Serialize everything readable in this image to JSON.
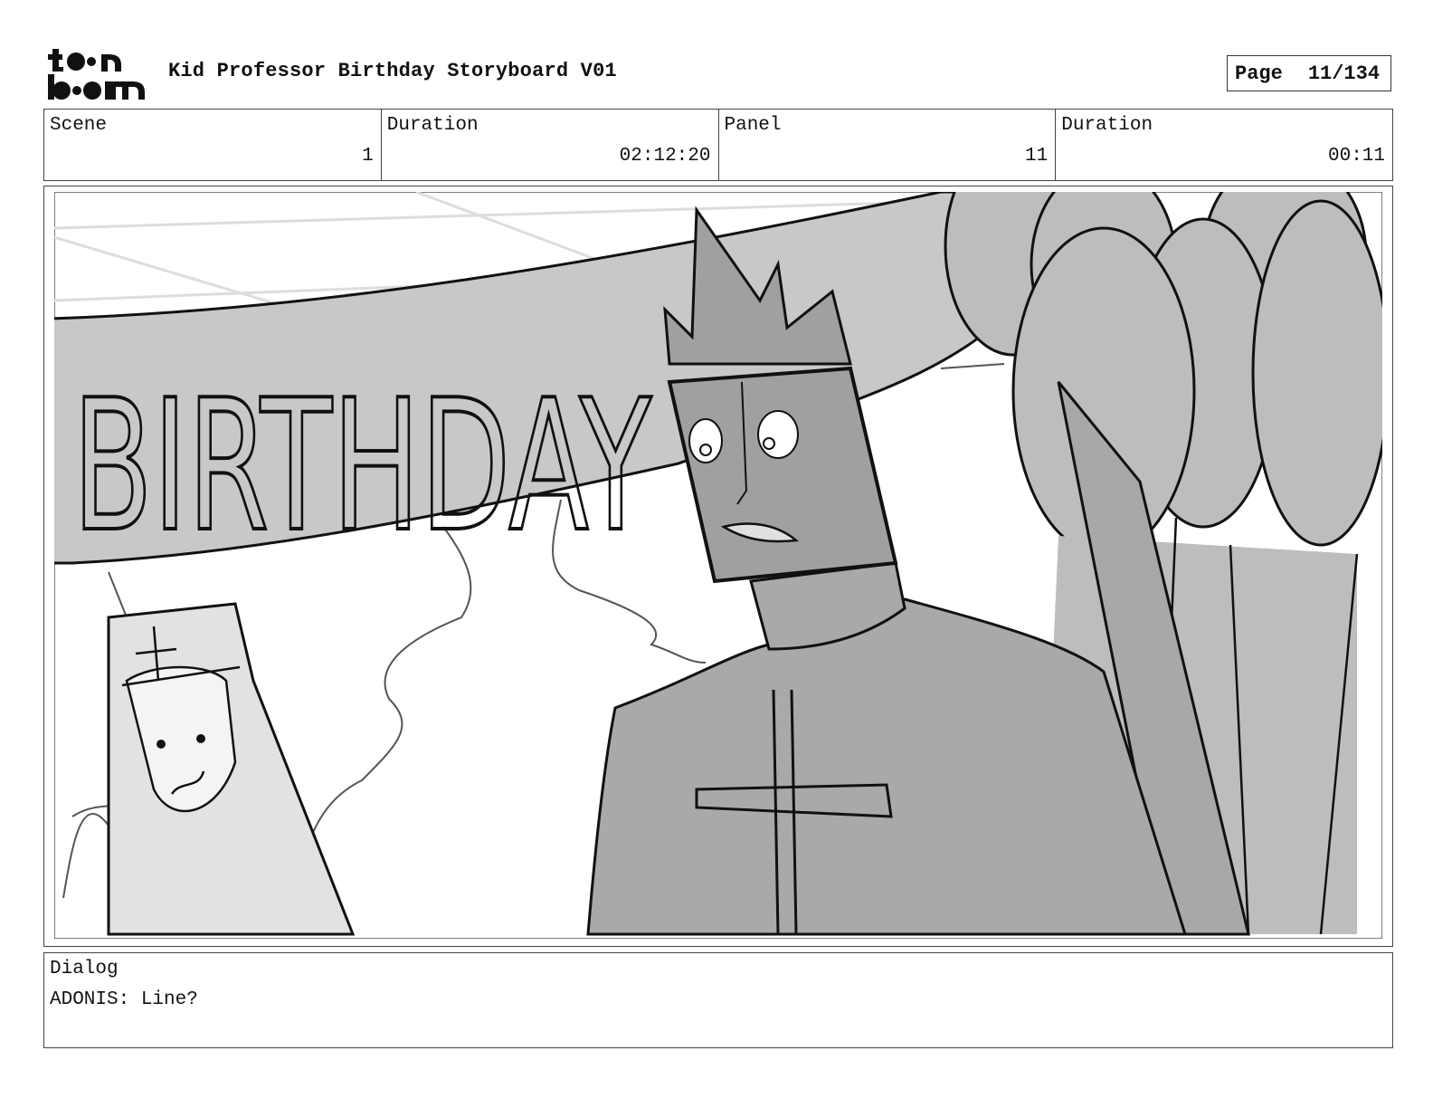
{
  "header": {
    "logo_text": "toon boom",
    "title": "Kid Professor Birthday Storyboard V01",
    "page_label": "Page",
    "page_value": "11/134"
  },
  "info": {
    "scene_label": "Scene",
    "scene_value": "1",
    "scene_duration_label": "Duration",
    "scene_duration_value": "02:12:20",
    "panel_label": "Panel",
    "panel_value": "11",
    "panel_duration_label": "Duration",
    "panel_duration_value": "00:11"
  },
  "panel": {
    "banner_text": "BIRTHDAY"
  },
  "dialog": {
    "label": "Dialog",
    "text": "ADONIS: Line?"
  }
}
